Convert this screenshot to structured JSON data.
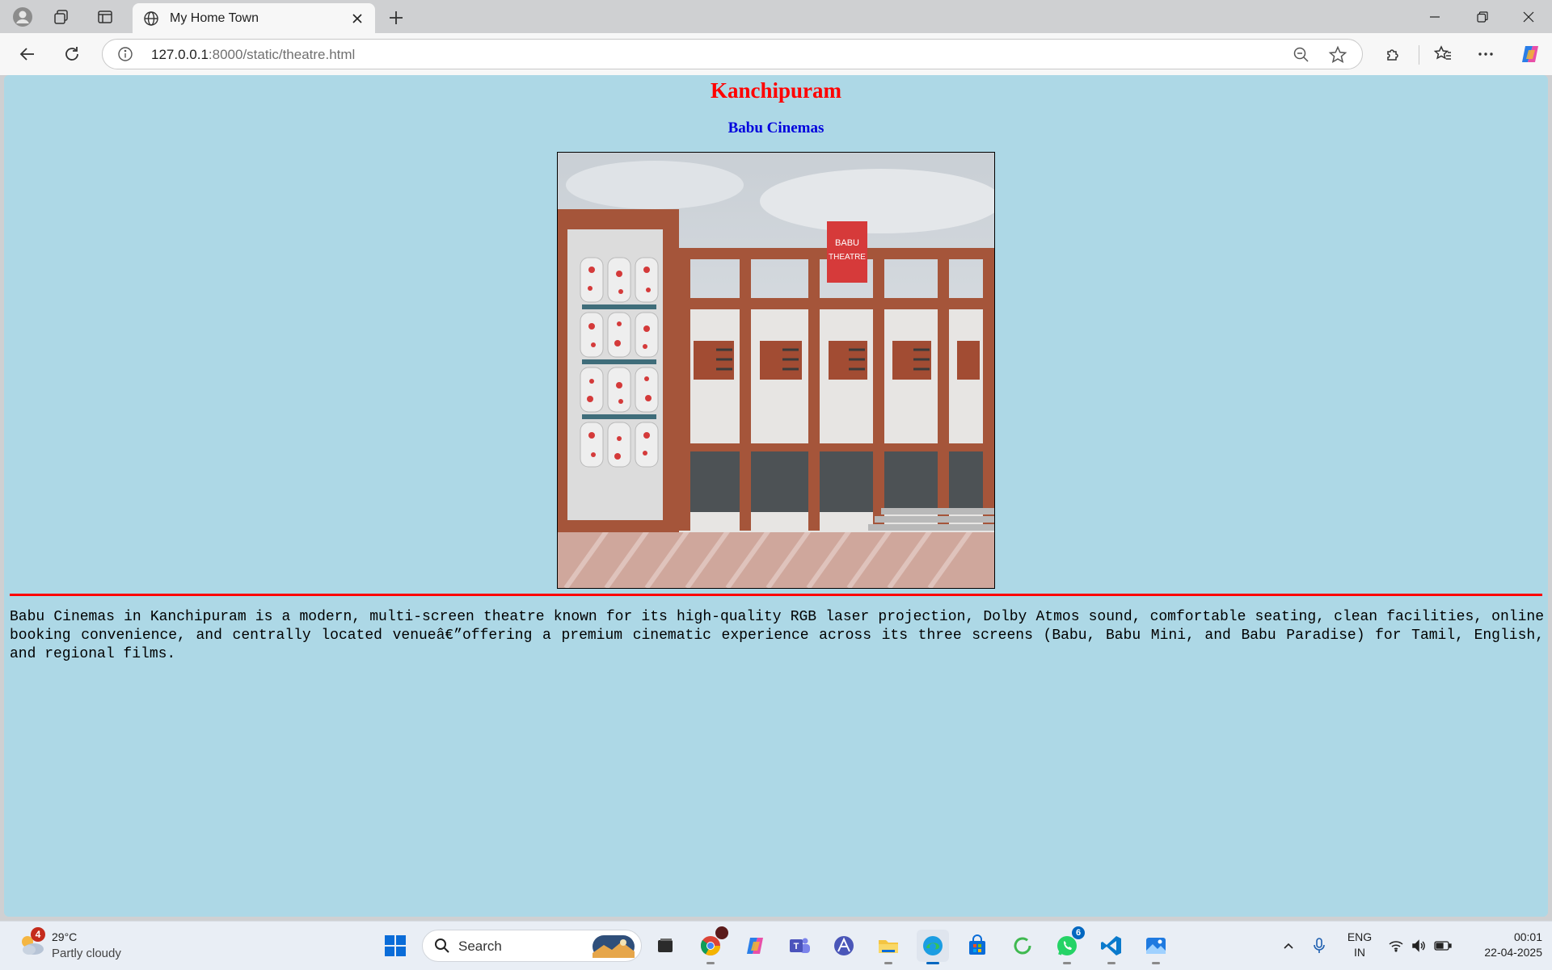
{
  "browser": {
    "tab_title": "My Home Town",
    "url_host": "127.0.0.1",
    "url_rest": ":8000/static/theatre.html"
  },
  "page": {
    "heading": "Kanchipuram",
    "subheading": "Babu Cinemas",
    "photo_sign_line1": "BABU",
    "photo_sign_line2": "THEATRE",
    "description": "Babu Cinemas in Kanchipuram is a modern, multi-screen theatre known for its high-quality RGB laser projection, Dolby Atmos sound, comfortable seating, clean facilities, online booking convenience, and centrally located venueâ€”offering a premium cinematic experience across its three screens (Babu, Babu Mini, and Babu Paradise) for Tamil, English, and regional films.",
    "background_color": "#add8e6",
    "heading_color": "#ff0000",
    "subheading_color": "#0000dd",
    "rule_color": "#ff0000"
  },
  "taskbar": {
    "weather_badge": "4",
    "temperature": "29°C",
    "condition": "Partly cloudy",
    "search_placeholder": "Search",
    "whatsapp_badge": "6",
    "lang_line1": "ENG",
    "lang_line2": "IN",
    "time": "00:01",
    "date": "22-04-2025"
  }
}
